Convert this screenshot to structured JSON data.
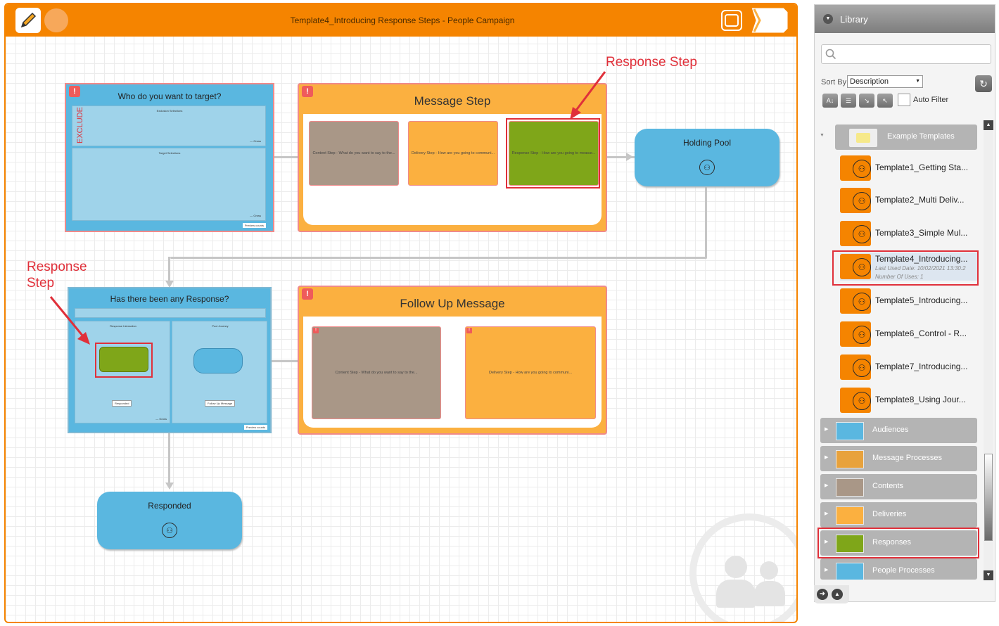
{
  "window": {
    "title": "Template4_Introducing Response Steps - People Campaign"
  },
  "colors": {
    "accent": "#f58400",
    "selection": "#5ab7e0",
    "message": "#fbb040",
    "content": "#a99787",
    "response": "#7fa619",
    "highlight": "#e0303a"
  },
  "toolbar": {
    "edit_icon": "pencil-icon",
    "view_icon": "rectangle-icon",
    "panel_icon": "panel-arrow-icon"
  },
  "canvas": {
    "selection1": {
      "title": "Who do you want to target?",
      "exclude_label": "EXCLUDE",
      "exclusion_label": "Exclusion Selections",
      "target_label": "Target Selections",
      "gross": "— Gross",
      "preview": "Preview counts"
    },
    "message1": {
      "title": "Message Step",
      "cards": [
        "Content Step - What do you want to say to the...",
        "Delivery Step - How are you going to communi...",
        "Response Step - How are you going to measur..."
      ]
    },
    "pool1": {
      "label": "Holding Pool"
    },
    "selection2": {
      "title": "Has there been any Response?",
      "left_label": "Response Interaction",
      "right_label": "Pool Journey",
      "left_select": "Responded",
      "right_select": "Follow Up Message",
      "gross": "— Gross",
      "preview": "Preview counts"
    },
    "message2": {
      "title": "Follow Up Message",
      "cards": [
        "Content Step - What do you want to say to the...",
        "Delivery Step - How are you going to communi..."
      ]
    },
    "pool2": {
      "label": "Responded"
    }
  },
  "annotations": {
    "top": "Response Step",
    "left_line1": "Response",
    "left_line2": "Step"
  },
  "library": {
    "title": "Library",
    "search_placeholder": "",
    "sort_label": "Sort By",
    "sort_value": "Description",
    "auto_filter": "Auto Filter",
    "folder": "Example Templates",
    "templates": [
      {
        "label": "Template1_Getting Sta..."
      },
      {
        "label": "Template2_Multi Deliv..."
      },
      {
        "label": "Template3_Simple Mul..."
      },
      {
        "label": "Template4_Introducing...",
        "last_used": "Last Used Date: 10/02/2021 13:30:2",
        "uses": "Number Of Uses: 1"
      },
      {
        "label": "Template5_Introducing..."
      },
      {
        "label": "Template6_Control - R..."
      },
      {
        "label": "Template7_Introducing..."
      },
      {
        "label": "Template8_Using Jour..."
      }
    ],
    "categories": [
      {
        "label": "Audiences",
        "color": "#5ab7e0"
      },
      {
        "label": "Message Processes",
        "color": "#e8a23c"
      },
      {
        "label": "Contents",
        "color": "#a99787"
      },
      {
        "label": "Deliveries",
        "color": "#fbb040"
      },
      {
        "label": "Responses",
        "color": "#7fa619"
      },
      {
        "label": "People Processes",
        "color": "#5ab7e0"
      }
    ]
  }
}
